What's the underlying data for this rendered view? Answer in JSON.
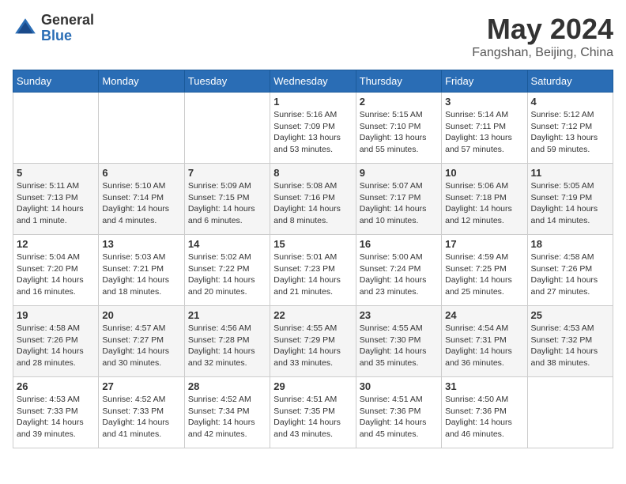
{
  "logo": {
    "general": "General",
    "blue": "Blue"
  },
  "header": {
    "title": "May 2024",
    "subtitle": "Fangshan, Beijing, China"
  },
  "weekdays": [
    "Sunday",
    "Monday",
    "Tuesday",
    "Wednesday",
    "Thursday",
    "Friday",
    "Saturday"
  ],
  "weeks": [
    [
      {
        "day": "",
        "info": ""
      },
      {
        "day": "",
        "info": ""
      },
      {
        "day": "",
        "info": ""
      },
      {
        "day": "1",
        "info": "Sunrise: 5:16 AM\nSunset: 7:09 PM\nDaylight: 13 hours and 53 minutes."
      },
      {
        "day": "2",
        "info": "Sunrise: 5:15 AM\nSunset: 7:10 PM\nDaylight: 13 hours and 55 minutes."
      },
      {
        "day": "3",
        "info": "Sunrise: 5:14 AM\nSunset: 7:11 PM\nDaylight: 13 hours and 57 minutes."
      },
      {
        "day": "4",
        "info": "Sunrise: 5:12 AM\nSunset: 7:12 PM\nDaylight: 13 hours and 59 minutes."
      }
    ],
    [
      {
        "day": "5",
        "info": "Sunrise: 5:11 AM\nSunset: 7:13 PM\nDaylight: 14 hours and 1 minute."
      },
      {
        "day": "6",
        "info": "Sunrise: 5:10 AM\nSunset: 7:14 PM\nDaylight: 14 hours and 4 minutes."
      },
      {
        "day": "7",
        "info": "Sunrise: 5:09 AM\nSunset: 7:15 PM\nDaylight: 14 hours and 6 minutes."
      },
      {
        "day": "8",
        "info": "Sunrise: 5:08 AM\nSunset: 7:16 PM\nDaylight: 14 hours and 8 minutes."
      },
      {
        "day": "9",
        "info": "Sunrise: 5:07 AM\nSunset: 7:17 PM\nDaylight: 14 hours and 10 minutes."
      },
      {
        "day": "10",
        "info": "Sunrise: 5:06 AM\nSunset: 7:18 PM\nDaylight: 14 hours and 12 minutes."
      },
      {
        "day": "11",
        "info": "Sunrise: 5:05 AM\nSunset: 7:19 PM\nDaylight: 14 hours and 14 minutes."
      }
    ],
    [
      {
        "day": "12",
        "info": "Sunrise: 5:04 AM\nSunset: 7:20 PM\nDaylight: 14 hours and 16 minutes."
      },
      {
        "day": "13",
        "info": "Sunrise: 5:03 AM\nSunset: 7:21 PM\nDaylight: 14 hours and 18 minutes."
      },
      {
        "day": "14",
        "info": "Sunrise: 5:02 AM\nSunset: 7:22 PM\nDaylight: 14 hours and 20 minutes."
      },
      {
        "day": "15",
        "info": "Sunrise: 5:01 AM\nSunset: 7:23 PM\nDaylight: 14 hours and 21 minutes."
      },
      {
        "day": "16",
        "info": "Sunrise: 5:00 AM\nSunset: 7:24 PM\nDaylight: 14 hours and 23 minutes."
      },
      {
        "day": "17",
        "info": "Sunrise: 4:59 AM\nSunset: 7:25 PM\nDaylight: 14 hours and 25 minutes."
      },
      {
        "day": "18",
        "info": "Sunrise: 4:58 AM\nSunset: 7:26 PM\nDaylight: 14 hours and 27 minutes."
      }
    ],
    [
      {
        "day": "19",
        "info": "Sunrise: 4:58 AM\nSunset: 7:26 PM\nDaylight: 14 hours and 28 minutes."
      },
      {
        "day": "20",
        "info": "Sunrise: 4:57 AM\nSunset: 7:27 PM\nDaylight: 14 hours and 30 minutes."
      },
      {
        "day": "21",
        "info": "Sunrise: 4:56 AM\nSunset: 7:28 PM\nDaylight: 14 hours and 32 minutes."
      },
      {
        "day": "22",
        "info": "Sunrise: 4:55 AM\nSunset: 7:29 PM\nDaylight: 14 hours and 33 minutes."
      },
      {
        "day": "23",
        "info": "Sunrise: 4:55 AM\nSunset: 7:30 PM\nDaylight: 14 hours and 35 minutes."
      },
      {
        "day": "24",
        "info": "Sunrise: 4:54 AM\nSunset: 7:31 PM\nDaylight: 14 hours and 36 minutes."
      },
      {
        "day": "25",
        "info": "Sunrise: 4:53 AM\nSunset: 7:32 PM\nDaylight: 14 hours and 38 minutes."
      }
    ],
    [
      {
        "day": "26",
        "info": "Sunrise: 4:53 AM\nSunset: 7:33 PM\nDaylight: 14 hours and 39 minutes."
      },
      {
        "day": "27",
        "info": "Sunrise: 4:52 AM\nSunset: 7:33 PM\nDaylight: 14 hours and 41 minutes."
      },
      {
        "day": "28",
        "info": "Sunrise: 4:52 AM\nSunset: 7:34 PM\nDaylight: 14 hours and 42 minutes."
      },
      {
        "day": "29",
        "info": "Sunrise: 4:51 AM\nSunset: 7:35 PM\nDaylight: 14 hours and 43 minutes."
      },
      {
        "day": "30",
        "info": "Sunrise: 4:51 AM\nSunset: 7:36 PM\nDaylight: 14 hours and 45 minutes."
      },
      {
        "day": "31",
        "info": "Sunrise: 4:50 AM\nSunset: 7:36 PM\nDaylight: 14 hours and 46 minutes."
      },
      {
        "day": "",
        "info": ""
      }
    ]
  ]
}
